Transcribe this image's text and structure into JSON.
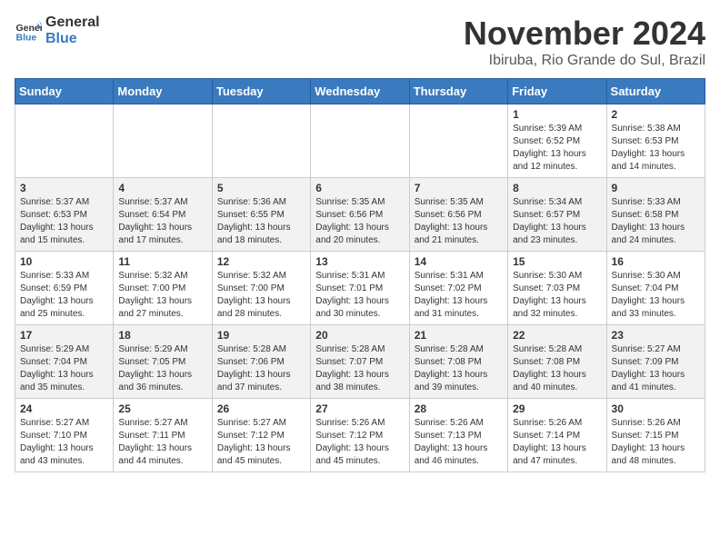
{
  "header": {
    "logo_general": "General",
    "logo_blue": "Blue",
    "month": "November 2024",
    "location": "Ibiruba, Rio Grande do Sul, Brazil"
  },
  "weekdays": [
    "Sunday",
    "Monday",
    "Tuesday",
    "Wednesday",
    "Thursday",
    "Friday",
    "Saturday"
  ],
  "weeks": [
    [
      {
        "day": "",
        "info": ""
      },
      {
        "day": "",
        "info": ""
      },
      {
        "day": "",
        "info": ""
      },
      {
        "day": "",
        "info": ""
      },
      {
        "day": "",
        "info": ""
      },
      {
        "day": "1",
        "info": "Sunrise: 5:39 AM\nSunset: 6:52 PM\nDaylight: 13 hours and 12 minutes."
      },
      {
        "day": "2",
        "info": "Sunrise: 5:38 AM\nSunset: 6:53 PM\nDaylight: 13 hours and 14 minutes."
      }
    ],
    [
      {
        "day": "3",
        "info": "Sunrise: 5:37 AM\nSunset: 6:53 PM\nDaylight: 13 hours and 15 minutes."
      },
      {
        "day": "4",
        "info": "Sunrise: 5:37 AM\nSunset: 6:54 PM\nDaylight: 13 hours and 17 minutes."
      },
      {
        "day": "5",
        "info": "Sunrise: 5:36 AM\nSunset: 6:55 PM\nDaylight: 13 hours and 18 minutes."
      },
      {
        "day": "6",
        "info": "Sunrise: 5:35 AM\nSunset: 6:56 PM\nDaylight: 13 hours and 20 minutes."
      },
      {
        "day": "7",
        "info": "Sunrise: 5:35 AM\nSunset: 6:56 PM\nDaylight: 13 hours and 21 minutes."
      },
      {
        "day": "8",
        "info": "Sunrise: 5:34 AM\nSunset: 6:57 PM\nDaylight: 13 hours and 23 minutes."
      },
      {
        "day": "9",
        "info": "Sunrise: 5:33 AM\nSunset: 6:58 PM\nDaylight: 13 hours and 24 minutes."
      }
    ],
    [
      {
        "day": "10",
        "info": "Sunrise: 5:33 AM\nSunset: 6:59 PM\nDaylight: 13 hours and 25 minutes."
      },
      {
        "day": "11",
        "info": "Sunrise: 5:32 AM\nSunset: 7:00 PM\nDaylight: 13 hours and 27 minutes."
      },
      {
        "day": "12",
        "info": "Sunrise: 5:32 AM\nSunset: 7:00 PM\nDaylight: 13 hours and 28 minutes."
      },
      {
        "day": "13",
        "info": "Sunrise: 5:31 AM\nSunset: 7:01 PM\nDaylight: 13 hours and 30 minutes."
      },
      {
        "day": "14",
        "info": "Sunrise: 5:31 AM\nSunset: 7:02 PM\nDaylight: 13 hours and 31 minutes."
      },
      {
        "day": "15",
        "info": "Sunrise: 5:30 AM\nSunset: 7:03 PM\nDaylight: 13 hours and 32 minutes."
      },
      {
        "day": "16",
        "info": "Sunrise: 5:30 AM\nSunset: 7:04 PM\nDaylight: 13 hours and 33 minutes."
      }
    ],
    [
      {
        "day": "17",
        "info": "Sunrise: 5:29 AM\nSunset: 7:04 PM\nDaylight: 13 hours and 35 minutes."
      },
      {
        "day": "18",
        "info": "Sunrise: 5:29 AM\nSunset: 7:05 PM\nDaylight: 13 hours and 36 minutes."
      },
      {
        "day": "19",
        "info": "Sunrise: 5:28 AM\nSunset: 7:06 PM\nDaylight: 13 hours and 37 minutes."
      },
      {
        "day": "20",
        "info": "Sunrise: 5:28 AM\nSunset: 7:07 PM\nDaylight: 13 hours and 38 minutes."
      },
      {
        "day": "21",
        "info": "Sunrise: 5:28 AM\nSunset: 7:08 PM\nDaylight: 13 hours and 39 minutes."
      },
      {
        "day": "22",
        "info": "Sunrise: 5:28 AM\nSunset: 7:08 PM\nDaylight: 13 hours and 40 minutes."
      },
      {
        "day": "23",
        "info": "Sunrise: 5:27 AM\nSunset: 7:09 PM\nDaylight: 13 hours and 41 minutes."
      }
    ],
    [
      {
        "day": "24",
        "info": "Sunrise: 5:27 AM\nSunset: 7:10 PM\nDaylight: 13 hours and 43 minutes."
      },
      {
        "day": "25",
        "info": "Sunrise: 5:27 AM\nSunset: 7:11 PM\nDaylight: 13 hours and 44 minutes."
      },
      {
        "day": "26",
        "info": "Sunrise: 5:27 AM\nSunset: 7:12 PM\nDaylight: 13 hours and 45 minutes."
      },
      {
        "day": "27",
        "info": "Sunrise: 5:26 AM\nSunset: 7:12 PM\nDaylight: 13 hours and 45 minutes."
      },
      {
        "day": "28",
        "info": "Sunrise: 5:26 AM\nSunset: 7:13 PM\nDaylight: 13 hours and 46 minutes."
      },
      {
        "day": "29",
        "info": "Sunrise: 5:26 AM\nSunset: 7:14 PM\nDaylight: 13 hours and 47 minutes."
      },
      {
        "day": "30",
        "info": "Sunrise: 5:26 AM\nSunset: 7:15 PM\nDaylight: 13 hours and 48 minutes."
      }
    ]
  ]
}
